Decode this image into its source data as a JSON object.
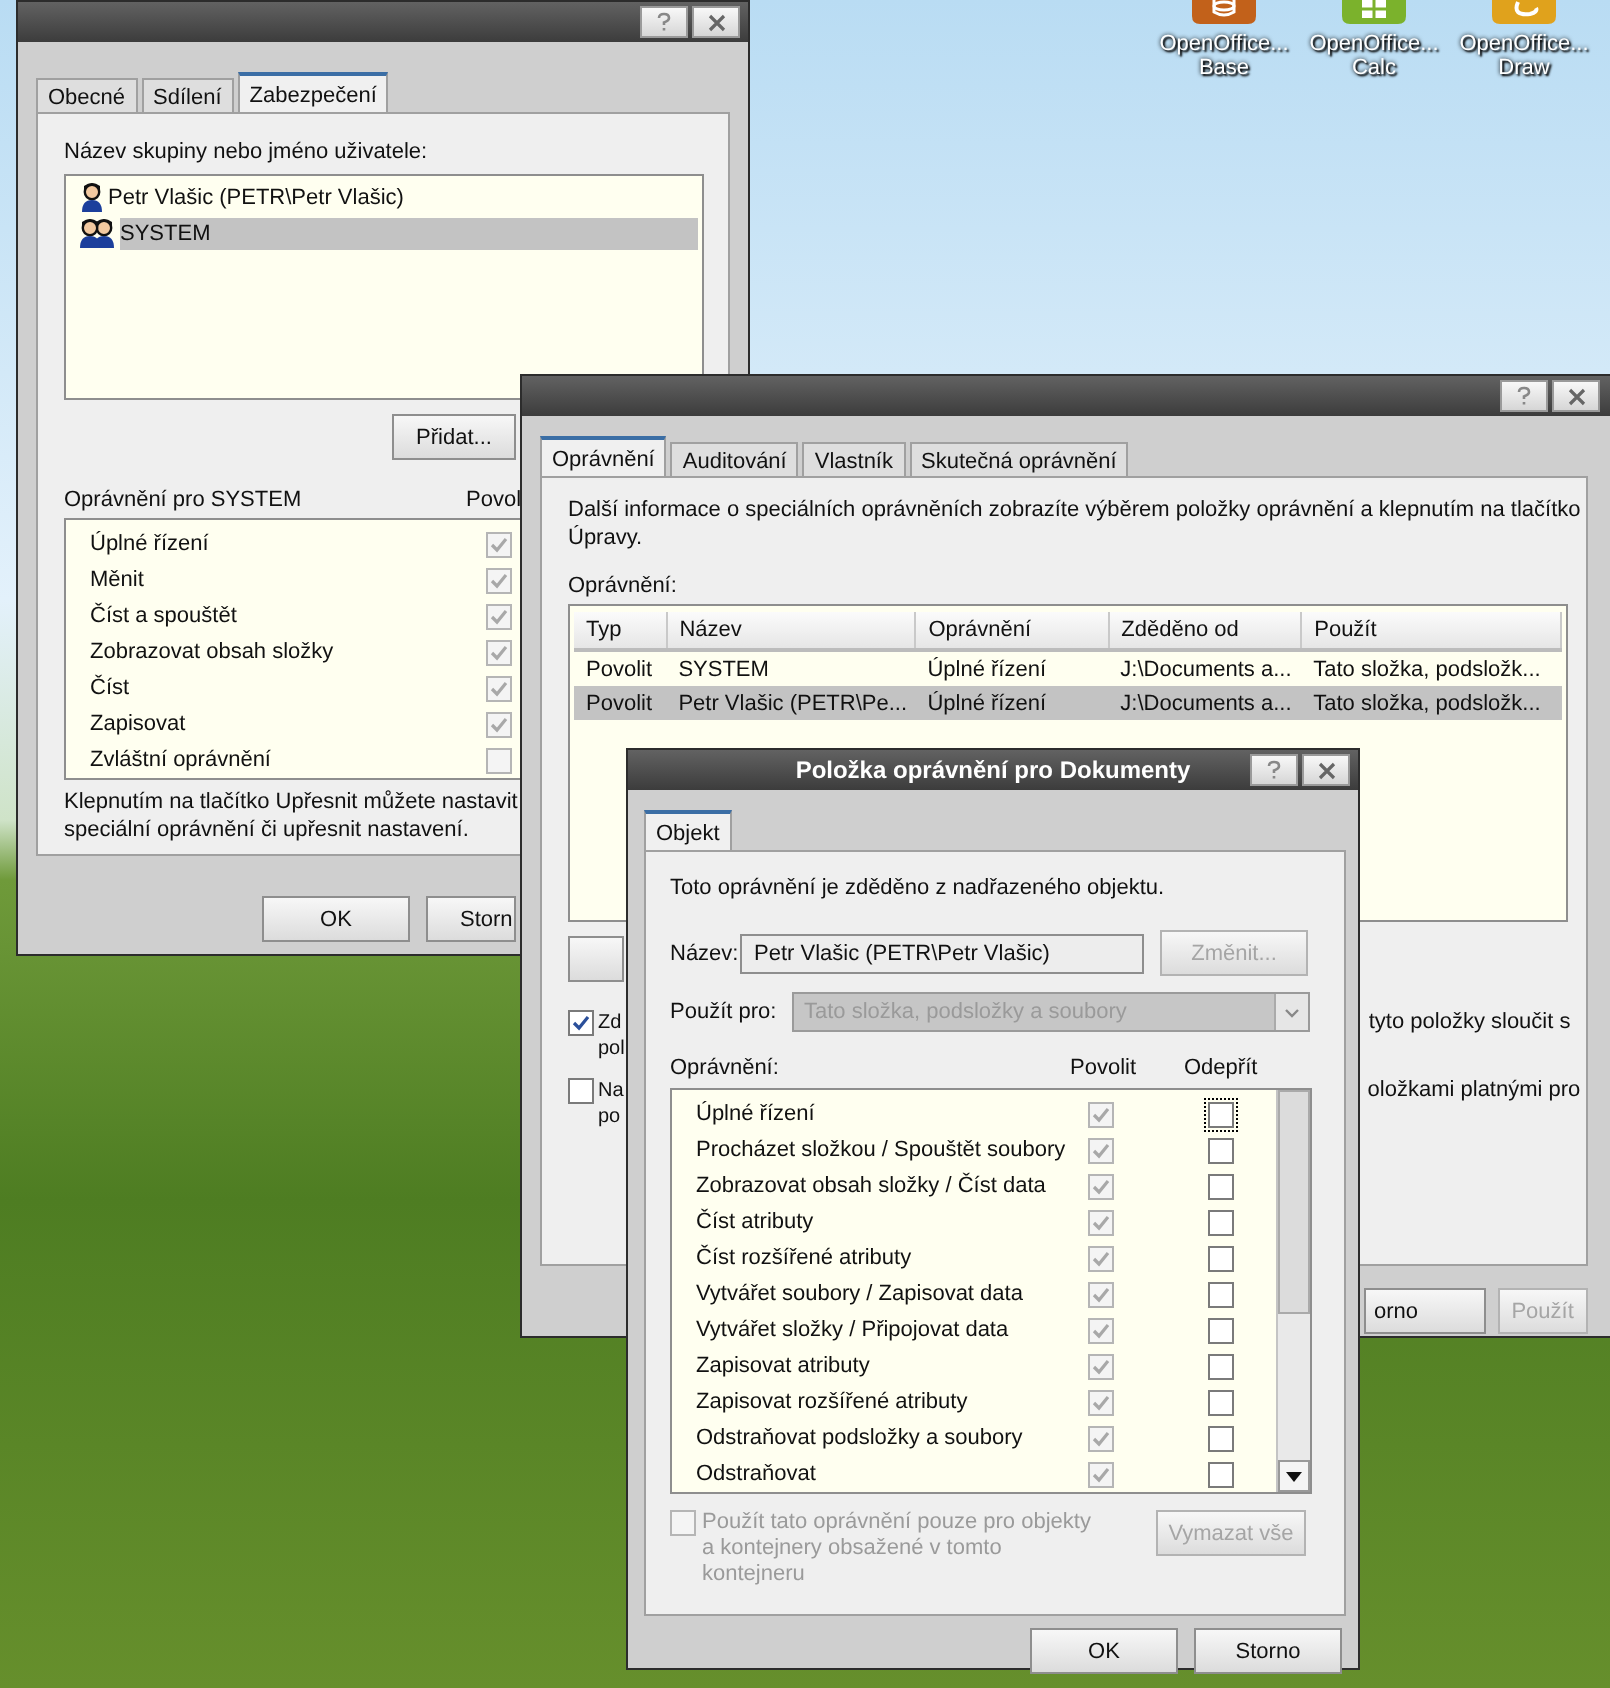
{
  "desktop_icons": [
    {
      "kind": "base",
      "label_lines": [
        "OpenOffice...",
        "Base"
      ]
    },
    {
      "kind": "calc",
      "label_lines": [
        "OpenOffice...",
        "Calc"
      ]
    },
    {
      "kind": "draw",
      "label_lines": [
        "OpenOffice...",
        "Draw"
      ]
    }
  ],
  "properties_window": {
    "tabs": [
      {
        "label": "Obecné",
        "selected": false
      },
      {
        "label": "Sdílení",
        "selected": false
      },
      {
        "label": "Zabezpečení",
        "selected": true
      }
    ],
    "principals_label": "Název skupiny nebo jméno uživatele:",
    "principals": [
      {
        "name": "Petr Vlašic (PETR\\Petr Vlašic)",
        "kind": "user",
        "selected": false
      },
      {
        "name": "SYSTEM",
        "kind": "group",
        "selected": true
      }
    ],
    "add_button": "Přidat...",
    "permissions_label": "Oprávnění pro SYSTEM",
    "allow_header": "Povol",
    "permissions": [
      {
        "name": "Úplné řízení",
        "allow": true,
        "disabled": true
      },
      {
        "name": "Měnit",
        "allow": true,
        "disabled": true
      },
      {
        "name": "Číst a spouštět",
        "allow": true,
        "disabled": true
      },
      {
        "name": "Zobrazovat obsah složky",
        "allow": true,
        "disabled": true
      },
      {
        "name": "Číst",
        "allow": true,
        "disabled": true
      },
      {
        "name": "Zapisovat",
        "allow": true,
        "disabled": true
      },
      {
        "name": "Zvláštní oprávnění",
        "allow": false,
        "disabled": true
      }
    ],
    "hint": "Klepnutím na tlačítko Upřesnit můžete nastavit speciální oprávnění či upřesnit nastavení.",
    "buttons": [
      "OK",
      "Storn"
    ]
  },
  "advanced_window": {
    "tabs": [
      {
        "label": "Oprávnění",
        "selected": true
      },
      {
        "label": "Auditování",
        "selected": false
      },
      {
        "label": "Vlastník",
        "selected": false
      },
      {
        "label": "Skutečná oprávnění",
        "selected": false
      }
    ],
    "description": "Další informace o speciálních oprávněních zobrazíte výběrem položky oprávnění a klepnutím na tlačítko Úpravy.",
    "permissions_label": "Oprávnění:",
    "table": {
      "columns": [
        "Typ",
        "Název",
        "Oprávnění",
        "Zděděno od",
        "Použít"
      ],
      "rows": [
        {
          "cells": [
            "Povolit",
            "SYSTEM",
            "Úplné řízení",
            "J:\\Documents a...",
            "Tato složka, podsložk..."
          ],
          "selected": false
        },
        {
          "cells": [
            "Povolit",
            "Petr Vlašic (PETR\\Pe...",
            "Úplné řízení",
            "J:\\Documents a...",
            "Tato složka, podsložk..."
          ],
          "selected": true
        }
      ]
    },
    "options": [
      {
        "checked": true,
        "start_lines": [
          "Zd",
          "pol"
        ],
        "end_lines": [
          "tyto položky sloučit s"
        ]
      },
      {
        "checked": false,
        "start_lines": [
          "Na",
          "po"
        ],
        "end_lines": [
          "oložkami platnými pro"
        ]
      }
    ],
    "buttons": [
      {
        "label": "orno",
        "disabled": false
      },
      {
        "label": "Použít",
        "disabled": true
      }
    ]
  },
  "entry_dialog": {
    "title": "Položka oprávnění pro Dokumenty",
    "tabs": [
      {
        "label": "Objekt",
        "selected": true
      }
    ],
    "inherited_note": "Toto oprávnění je zděděno z nadřazeného objektu.",
    "name_label": "Název:",
    "name_value": "Petr Vlašic (PETR\\Petr Vlašic)",
    "change_button": {
      "label": "Změnit...",
      "disabled": true
    },
    "apply_to_label": "Použít pro:",
    "apply_to": {
      "value": "Tato složka, podsložky a soubory",
      "disabled": true
    },
    "permissions_label": "Oprávnění:",
    "allow_header": "Povolit",
    "deny_header": "Odepřít",
    "permissions": [
      {
        "name": "Úplné řízení",
        "allow": true,
        "deny": false,
        "disabled": true,
        "focused": true
      },
      {
        "name": "Procházet složkou / Spouštět soubory",
        "allow": true,
        "deny": false,
        "disabled": true,
        "focused": false
      },
      {
        "name": "Zobrazovat obsah složky / Číst data",
        "allow": true,
        "deny": false,
        "disabled": true,
        "focused": false
      },
      {
        "name": "Číst atributy",
        "allow": true,
        "deny": false,
        "disabled": true,
        "focused": false
      },
      {
        "name": "Číst rozšířené atributy",
        "allow": true,
        "deny": false,
        "disabled": true,
        "focused": false
      },
      {
        "name": "Vytvářet soubory / Zapisovat data",
        "allow": true,
        "deny": false,
        "disabled": true,
        "focused": false
      },
      {
        "name": "Vytvářet složky / Připojovat data",
        "allow": true,
        "deny": false,
        "disabled": true,
        "focused": false
      },
      {
        "name": "Zapisovat atributy",
        "allow": true,
        "deny": false,
        "disabled": true,
        "focused": false
      },
      {
        "name": "Zapisovat rozšířené atributy",
        "allow": true,
        "deny": false,
        "disabled": true,
        "focused": false
      },
      {
        "name": "Odstraňovat podsložky a soubory",
        "allow": true,
        "deny": false,
        "disabled": true,
        "focused": false
      },
      {
        "name": "Odstraňovat",
        "allow": true,
        "deny": false,
        "disabled": true,
        "focused": false
      }
    ],
    "apply_only_inside": {
      "label": "Použít tato oprávnění pouze pro objekty a kontejnery obsažené v tomto kontejneru",
      "checked": false,
      "disabled": true
    },
    "clear_button": {
      "label": "Vymazat vše",
      "disabled": true
    },
    "buttons": [
      "OK",
      "Storno"
    ]
  }
}
